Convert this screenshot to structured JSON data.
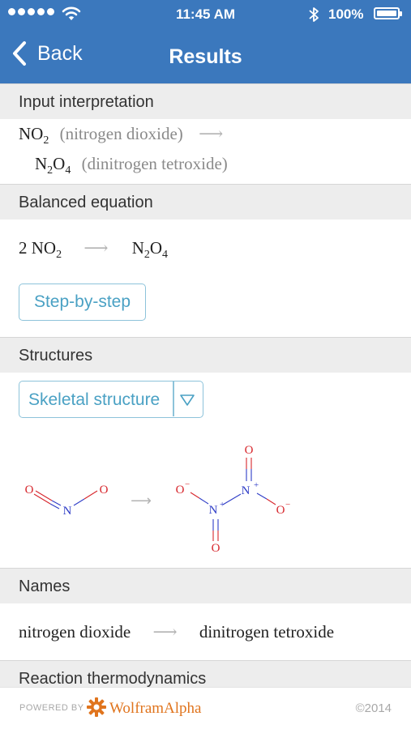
{
  "status_bar": {
    "time": "11:45 AM",
    "battery": "100%"
  },
  "nav": {
    "back_label": "Back",
    "title": "Results"
  },
  "pods": {
    "input_interpretation": {
      "title": "Input interpretation",
      "reactant_name": "(nitrogen dioxide)",
      "product_name": "(dinitrogen tetroxide)"
    },
    "balanced_equation": {
      "title": "Balanced equation",
      "coefficient": "2",
      "step_button": "Step-by-step"
    },
    "structures": {
      "title": "Structures",
      "dropdown_selected": "Skeletal structure"
    },
    "names": {
      "title": "Names",
      "reactant": "nitrogen dioxide",
      "product": "dinitrogen tetroxide"
    },
    "reaction_thermodynamics": {
      "title": "Reaction thermodynamics"
    }
  },
  "structure_labels": {
    "oxygen": "O",
    "nitrogen": "N"
  },
  "footer": {
    "powered_by": "POWERED BY",
    "brand": "WolframAlpha",
    "copyright": "©2014"
  },
  "colors": {
    "header_blue": "#3b78bd",
    "accent": "#4aa1c4",
    "oxygen": "#d7262c",
    "nitrogen": "#2f3dc7",
    "brand_orange": "#e0741d"
  }
}
